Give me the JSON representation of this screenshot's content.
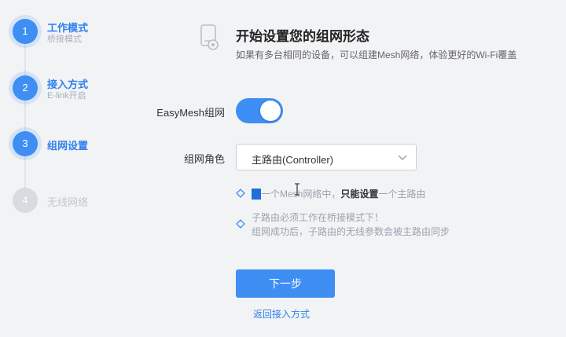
{
  "steps": [
    {
      "num": "1",
      "title": "工作模式",
      "sub": "桥接模式",
      "state": "done"
    },
    {
      "num": "2",
      "title": "接入方式",
      "sub": "E-link开启",
      "state": "done"
    },
    {
      "num": "3",
      "title": "组网设置",
      "sub": "",
      "state": "active"
    },
    {
      "num": "4",
      "title": "无线网络",
      "sub": "",
      "state": "pending"
    }
  ],
  "header": {
    "icon": "router-icon",
    "title": "开始设置您的组网形态",
    "subtitle": "如果有多台相同的设备，可以组建Mesh网络，体验更好的Wi-Fi覆盖"
  },
  "form": {
    "easymesh_label": "EasyMesh组网",
    "easymesh_enabled": true,
    "role_label": "组网角色",
    "role_value": "主路由(Controller)"
  },
  "tips": {
    "tip1_part1": "一个Mesh网络中，",
    "tip1_bold": "只能设置",
    "tip1_part2": "一个主路由",
    "tip2_line1": "子路由必须工作在桥接模式下！",
    "tip2_line2": "组网成功后，子路由的无线参数会被主路由同步"
  },
  "actions": {
    "next_label": "下一步",
    "back_label": "返回接入方式"
  },
  "colors": {
    "accent": "#3f8ef4",
    "link": "#2f80ed",
    "disabled": "#d8dbe0"
  }
}
